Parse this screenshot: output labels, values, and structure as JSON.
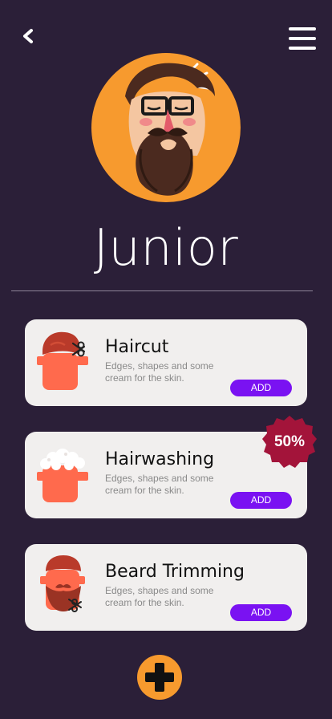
{
  "header": {
    "back_icon": "chevron-left-icon",
    "menu_icon": "hamburger-menu-icon"
  },
  "profile": {
    "name": "Junior",
    "avatar_colors": {
      "background": "#f79a2e",
      "hair": "#4b2a1f",
      "skin": "#f4c6a1"
    }
  },
  "services": [
    {
      "title": "Haircut",
      "description": "Edges, shapes and some cream for the skin.",
      "button_label": "ADD",
      "icon": "haircut-icon"
    },
    {
      "title": "Hairwashing",
      "description": "Edges, shapes and some cream for the skin.",
      "button_label": "ADD",
      "icon": "hairwashing-icon",
      "badge": "50%"
    },
    {
      "title": "Beard Trimming",
      "description": "Edges, shapes and some cream for the skin.",
      "button_label": "ADD",
      "icon": "beard-trimming-icon"
    }
  ],
  "fab": {
    "icon": "plus-icon"
  },
  "colors": {
    "background": "#2b1f38",
    "card": "#f1efee",
    "accent": "#7a12f2",
    "orange": "#f79a2e",
    "badge": "#a3143a"
  }
}
